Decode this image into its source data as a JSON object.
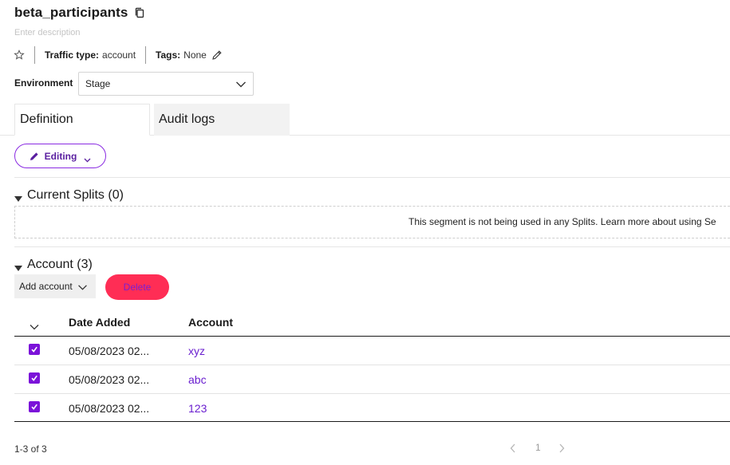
{
  "segment": {
    "title": "beta_participants",
    "description_placeholder": "Enter description",
    "traffic_type_label": "Traffic type:",
    "traffic_type_value": "account",
    "tags_label": "Tags:",
    "tags_value": "None"
  },
  "environment": {
    "label": "Environment",
    "selected": "Stage"
  },
  "tabs": [
    {
      "label": "Definition",
      "active": true
    },
    {
      "label": "Audit logs",
      "active": false
    }
  ],
  "mode_button": {
    "label": "Editing"
  },
  "current_splits": {
    "heading": "Current Splits (0)",
    "message": "This segment is not being used in any Splits. Learn more about using Se"
  },
  "accounts": {
    "heading": "Account (3)",
    "add_label": "Add account",
    "delete_label": "Delete",
    "columns": [
      "Date Added",
      "Account"
    ],
    "rows": [
      {
        "date": "05/08/2023 02...",
        "account": "xyz",
        "checked": true
      },
      {
        "date": "05/08/2023 02...",
        "account": "abc",
        "checked": true
      },
      {
        "date": "05/08/2023 02...",
        "account": "123",
        "checked": true
      }
    ]
  },
  "pagination": {
    "range": "1-3 of 3",
    "page": "1"
  },
  "colors": {
    "accent_purple": "#7b12d9",
    "delete_red": "#ff2d55",
    "link_purple": "#6a1fcf"
  },
  "icons": [
    "copy-icon",
    "star-icon",
    "pencil-icon",
    "chevron-down-icon",
    "triangle-down-icon",
    "checkmark-icon",
    "chevron-left-icon",
    "chevron-right-icon"
  ]
}
